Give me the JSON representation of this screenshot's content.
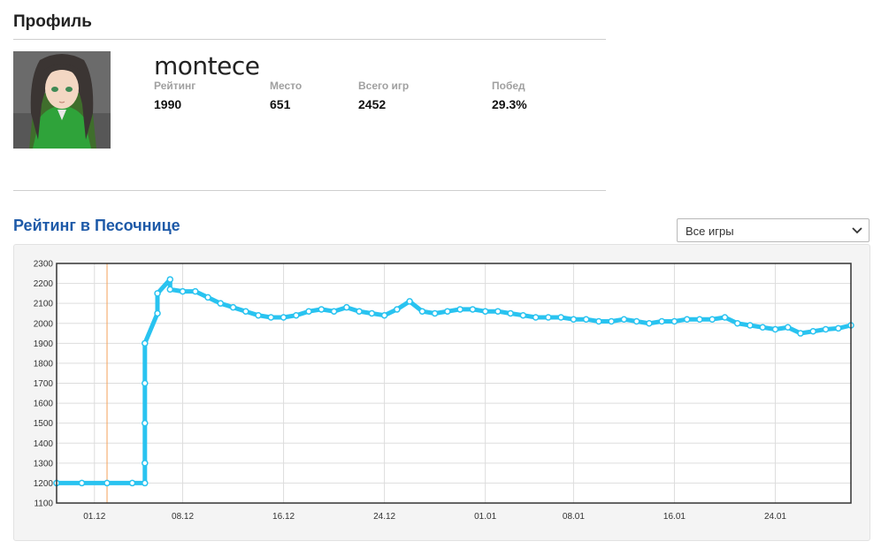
{
  "profile": {
    "title": "Профиль",
    "username": "montece",
    "stats": [
      {
        "label": "Рейтинг",
        "value": "1990"
      },
      {
        "label": "Место",
        "value": "651"
      },
      {
        "label": "Всего игр",
        "value": "2452"
      },
      {
        "label": "Побед",
        "value": "29.3%"
      }
    ]
  },
  "rating_section": {
    "title": "Рейтинг в Песочнице",
    "filter": {
      "selected": "Все игры"
    }
  },
  "colors": {
    "series": "#29c3f0",
    "marker_line": "#f5a25a",
    "section_title": "#1e5aa8"
  },
  "chart_data": {
    "type": "line",
    "title": "",
    "xlabel": "",
    "ylabel": "",
    "ylim": [
      1100,
      2300
    ],
    "y_ticks": [
      "2300",
      "2200",
      "2100",
      "2000",
      "1900",
      "1800",
      "1700",
      "1600",
      "1500",
      "1400",
      "1300",
      "1200",
      "1100"
    ],
    "x_ticks": [
      "01.12",
      "08.12",
      "16.12",
      "24.12",
      "01.01",
      "08.01",
      "16.01",
      "24.01"
    ],
    "x_range": [
      "2022-11-28",
      "2023-01-30"
    ],
    "x_tick_dates": [
      "2022-12-01",
      "2022-12-08",
      "2022-12-16",
      "2022-12-24",
      "2023-01-01",
      "2023-01-08",
      "2023-01-16",
      "2023-01-24"
    ],
    "marker_date": "2022-12-02",
    "grid": true,
    "legend": "none",
    "series": [
      {
        "points": [
          [
            "2022-11-28",
            1200
          ],
          [
            "2022-11-30",
            1200
          ],
          [
            "2022-12-02",
            1200
          ],
          [
            "2022-12-04",
            1200
          ],
          [
            "2022-12-05",
            1200
          ],
          [
            "2022-12-05",
            1300
          ],
          [
            "2022-12-05",
            1500
          ],
          [
            "2022-12-05",
            1700
          ],
          [
            "2022-12-05",
            1900
          ],
          [
            "2022-12-06",
            2050
          ],
          [
            "2022-12-06",
            2150
          ],
          [
            "2022-12-07",
            2220
          ],
          [
            "2022-12-07",
            2170
          ],
          [
            "2022-12-08",
            2160
          ],
          [
            "2022-12-09",
            2160
          ],
          [
            "2022-12-10",
            2130
          ],
          [
            "2022-12-11",
            2100
          ],
          [
            "2022-12-12",
            2080
          ],
          [
            "2022-12-13",
            2060
          ],
          [
            "2022-12-14",
            2040
          ],
          [
            "2022-12-15",
            2030
          ],
          [
            "2022-12-16",
            2030
          ],
          [
            "2022-12-17",
            2040
          ],
          [
            "2022-12-18",
            2060
          ],
          [
            "2022-12-19",
            2070
          ],
          [
            "2022-12-20",
            2060
          ],
          [
            "2022-12-21",
            2080
          ],
          [
            "2022-12-22",
            2060
          ],
          [
            "2022-12-23",
            2050
          ],
          [
            "2022-12-24",
            2040
          ],
          [
            "2022-12-25",
            2070
          ],
          [
            "2022-12-26",
            2110
          ],
          [
            "2022-12-27",
            2060
          ],
          [
            "2022-12-28",
            2050
          ],
          [
            "2022-12-29",
            2060
          ],
          [
            "2022-12-30",
            2070
          ],
          [
            "2022-12-31",
            2070
          ],
          [
            "2023-01-01",
            2060
          ],
          [
            "2023-01-02",
            2060
          ],
          [
            "2023-01-03",
            2050
          ],
          [
            "2023-01-04",
            2040
          ],
          [
            "2023-01-05",
            2030
          ],
          [
            "2023-01-06",
            2030
          ],
          [
            "2023-01-07",
            2030
          ],
          [
            "2023-01-08",
            2020
          ],
          [
            "2023-01-09",
            2020
          ],
          [
            "2023-01-10",
            2010
          ],
          [
            "2023-01-11",
            2010
          ],
          [
            "2023-01-12",
            2020
          ],
          [
            "2023-01-13",
            2010
          ],
          [
            "2023-01-14",
            2000
          ],
          [
            "2023-01-15",
            2010
          ],
          [
            "2023-01-16",
            2010
          ],
          [
            "2023-01-17",
            2020
          ],
          [
            "2023-01-18",
            2020
          ],
          [
            "2023-01-19",
            2020
          ],
          [
            "2023-01-20",
            2030
          ],
          [
            "2023-01-21",
            2000
          ],
          [
            "2023-01-22",
            1990
          ],
          [
            "2023-01-23",
            1980
          ],
          [
            "2023-01-24",
            1970
          ],
          [
            "2023-01-25",
            1980
          ],
          [
            "2023-01-26",
            1950
          ],
          [
            "2023-01-27",
            1960
          ],
          [
            "2023-01-28",
            1970
          ],
          [
            "2023-01-29",
            1975
          ],
          [
            "2023-01-30",
            1990
          ]
        ]
      }
    ]
  }
}
